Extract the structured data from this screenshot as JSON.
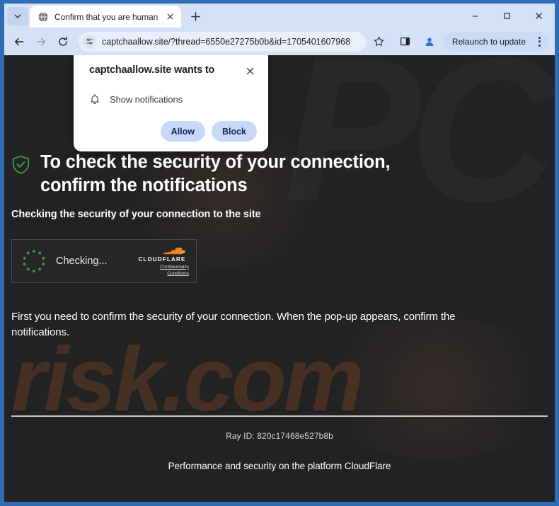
{
  "browser": {
    "tab": {
      "title": "Confirm that you are human",
      "favicon": "globe-icon",
      "close": "close-icon"
    },
    "new_tab_label": "+",
    "tab_search_icon": "chevron-down-icon",
    "window_controls": {
      "minimize": "minimize-icon",
      "maximize": "maximize-icon",
      "close": "close-icon"
    },
    "toolbar": {
      "back_icon": "back-arrow-icon",
      "forward_icon": "forward-arrow-icon",
      "reload_icon": "reload-icon",
      "site_settings_icon": "tune-icon",
      "url": "captchaallow.site/?thread=6550e27275b0b&id=1705401607968",
      "bookmark_icon": "star-icon",
      "side_panel_icon": "side-panel-icon",
      "profile_icon": "profile-avatar-icon",
      "relaunch_label": "Relaunch to update",
      "menu_icon": "kebab-menu-icon"
    }
  },
  "permission_dialog": {
    "title": "captchaallow.site wants to",
    "close_icon": "close-icon",
    "request_icon": "bell-icon",
    "request_label": "Show notifications",
    "allow_label": "Allow",
    "block_label": "Block"
  },
  "page": {
    "shield_icon": "shield-check-icon",
    "headline": "To check the security of your connection, confirm the notifications",
    "subhead": "Checking the security of your connection to the site",
    "widget": {
      "spinner_icon": "loading-spinner-icon",
      "status": "Checking...",
      "brand": "CLOUDFLARE",
      "cloud_icon": "cloudflare-cloud-icon",
      "link_confidentiality": "Confidentiality",
      "link_conditions": "Conditions"
    },
    "body_text": "First you need to confirm the security of your connection. When the pop-up appears, confirm the notifications.",
    "footer": {
      "ray_id": "Ray ID: 820c17468e527b8b",
      "platform": "Performance and security on the platform CloudFlare"
    },
    "watermark_primary": "risk.com",
    "watermark_secondary": "PC"
  },
  "colors": {
    "window_border": "#2e6db4",
    "chrome_bg": "#d5e1f7",
    "page_bg": "#222222",
    "accent_button": "#c8d9f7",
    "spinner_green": "#3f9447",
    "cloudflare_orange": "#f6821f",
    "shield_green": "#3e8e41"
  }
}
